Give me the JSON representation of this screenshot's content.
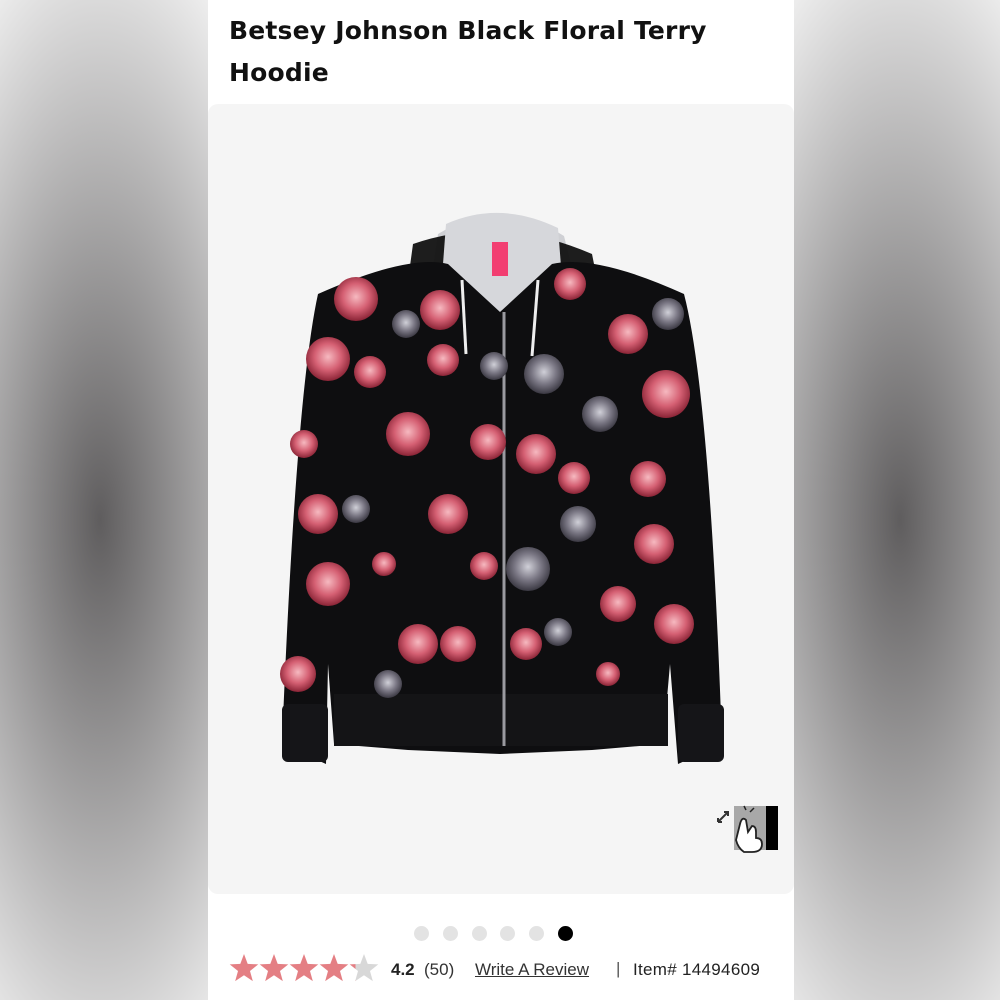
{
  "product": {
    "title": "Betsey Johnson Black Floral Terry Hoodie",
    "image_alt": "black floral zip hoodie",
    "gallery_count": 6,
    "gallery_active_index": 5
  },
  "rating": {
    "value": "4.2",
    "count": "(50)",
    "stars": 4.2,
    "write_review": "Write A Review",
    "separator": "|",
    "item_number": "Item# 14494609"
  },
  "colors": {
    "star_filled": "#e47f84",
    "star_empty": "#d8d8d8",
    "dot_active": "#000000",
    "dot_inactive": "#e3e3e3"
  },
  "icons": {
    "zoom": "expand-hand-icon"
  }
}
